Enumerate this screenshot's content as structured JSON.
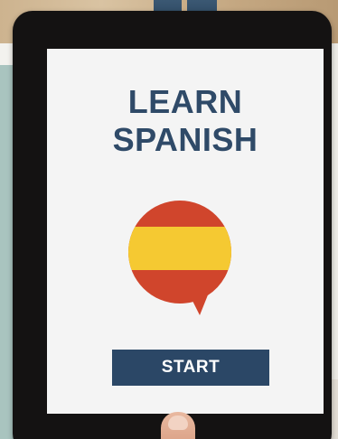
{
  "app": {
    "title_line1": "LEARN",
    "title_line2": "SPANISH",
    "start_label": "START"
  },
  "icons": {
    "flag_bubble": "spain-flag-speech-bubble-icon"
  },
  "colors": {
    "title": "#2f4a68",
    "button_bg": "#2b4766",
    "button_text": "#ffffff",
    "flag_red": "#d0452c",
    "flag_yellow": "#f5c932",
    "screen_bg": "#f4f4f4",
    "tablet_frame": "#141212"
  }
}
